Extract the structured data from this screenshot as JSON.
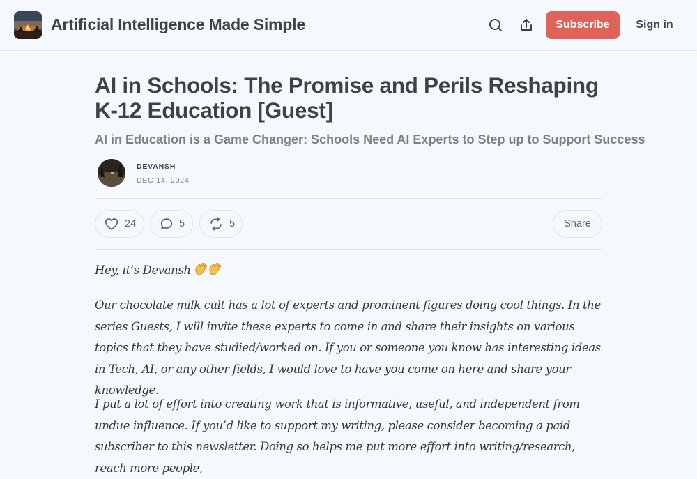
{
  "header": {
    "publication_title": "Artificial Intelligence Made Simple",
    "search_icon": "search-icon",
    "share_icon": "share-upload-icon",
    "subscribe_label": "Subscribe",
    "signin_label": "Sign in",
    "accent_color": "#e06359"
  },
  "post": {
    "title": "AI in Schools: The Promise and Perils Reshaping K-12 Education [Guest]",
    "subtitle": "AI in Education is a Game Changer: Schools Need AI Experts to Step up to Support Success",
    "author": "DEVANSH",
    "date": "DEC 14, 2024"
  },
  "actions": {
    "like_count": "24",
    "comment_count": "5",
    "restack_count": "5",
    "share_label": "Share"
  },
  "body": {
    "greeting": "Hey, it’s Devansh",
    "greeting_emoji": "👋👋",
    "paragraph_guests": "Our chocolate milk cult has a lot of experts and prominent figures doing cool things. In the series Guests, I will invite these experts to come in and share their insights on various topics that they have studied/worked on. If you or someone you know has interesting ideas in Tech, AI, or any other fields, I would love to have you come on here and share your knowledge.",
    "paragraph_support": "I put a lot of effort into creating work that is informative, useful, and independent from undue influence. If you’d like to support my writing, please consider becoming a paid subscriber to this newsletter. Doing so helps me put more effort into writing/research, reach more people,"
  }
}
